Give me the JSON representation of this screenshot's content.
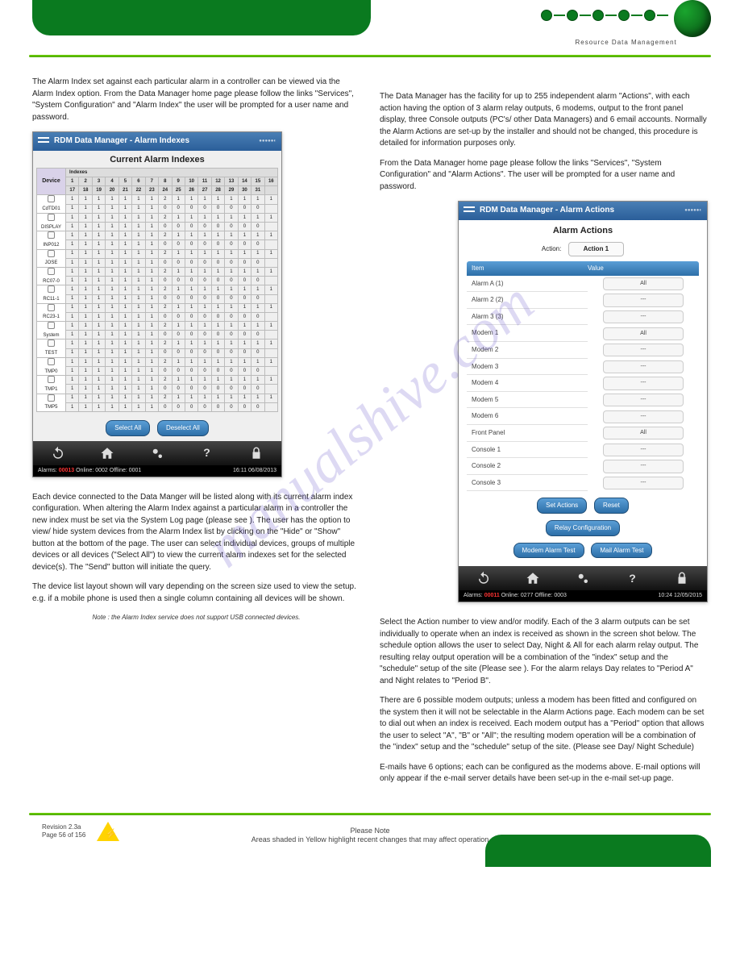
{
  "header": {
    "brand": "Resource Data Management"
  },
  "left": {
    "intro": "The Alarm Index set against each particular alarm in a controller can be viewed via the Alarm Index option. From the Data Manager home page please follow the links \"Services\", \"System Configuration\" and \"Alarm Index\" the user will be prompted for a user name and password.",
    "body": "Each device connected to the Data Manger will be listed along with its current alarm index configuration. When altering the Alarm Index against a particular alarm in a controller the new index must be set via the System Log page (please see ). The user has the option to view/ hide system devices from the Alarm Index list by clicking on the \"Hide\" or \"Show\" button at the bottom of the page. The user can select individual devices, groups of multiple devices or all devices (\"Select All\") to view the current alarm indexes set for the selected device(s). The \"Send\" button will initiate the query.",
    "listLabel": "The device list layout shown will vary depending on the screen size used to view the setup. e.g. if a mobile phone is used then a single column containing all devices will be shown.",
    "note": "Note : the Alarm Index service does not support USB connected devices."
  },
  "right": {
    "intro": "The Data Manager has the facility for up to 255 independent alarm \"Actions\", with each action having the option of 3 alarm relay outputs, 6 modems, output to the front panel display, three Console outputs (PC's/ other Data Managers) and 6 email accounts. Normally the Alarm Actions are set-up by the installer and should not be changed, this procedure is detailed for information purposes only.",
    "body": "From the Data Manager home page please follow the links \"Services\", \"System Configuration\" and \"Alarm Actions\". The user will be prompted for a user name and password.",
    "cfg1": "Select the Action number to view and/or modify. Each of the 3 alarm outputs can be set individually to operate when an index is received as shown in the screen shot below. The schedule option allows the user to select Day, Night & All for each alarm relay output. The resulting relay output operation will be a combination of the \"index\" setup and the \"schedule\" setup of the site (Please see ). For the alarm relays Day relates to \"Period A\" and Night relates to \"Period B\".",
    "cfg2": "There are 6 possible modem outputs; unless a modem has been fitted and configured on the system then it will not be selectable in the Alarm Actions page. Each modem can be set to dial out when an index is received. Each modem output has a \"Period\" option that allows the user to select \"A\", \"B\" or \"All\"; the resulting modem operation will be a combination of the \"index\" setup and the \"schedule\" setup of the site. (Please see Day/ Night Schedule)",
    "cfg3": "E-mails have 6 options; each can be configured as the modems above. E-mail options will only appear if the e-mail server details have been set-up in the e-mail set-up page."
  },
  "ss1": {
    "title": "RDM Data Manager - Alarm Indexes",
    "subtitle": "Current Alarm Indexes",
    "deviceHeader": "Device",
    "indexesHeader": "Indexes",
    "colsTop": [
      "1",
      "2",
      "3",
      "4",
      "5",
      "6",
      "7",
      "8",
      "9",
      "10",
      "11",
      "12",
      "13",
      "14",
      "15",
      "16"
    ],
    "colsBot": [
      "17",
      "18",
      "19",
      "20",
      "21",
      "22",
      "23",
      "24",
      "25",
      "26",
      "27",
      "28",
      "29",
      "30",
      "31",
      ""
    ],
    "rowTop": [
      "1",
      "1",
      "1",
      "1",
      "1",
      "1",
      "1",
      "2",
      "1",
      "1",
      "1",
      "1",
      "1",
      "1",
      "1",
      "1"
    ],
    "rowBot": [
      "1",
      "1",
      "1",
      "1",
      "1",
      "1",
      "1",
      "0",
      "0",
      "0",
      "0",
      "0",
      "0",
      "0",
      "0",
      ""
    ],
    "devices": [
      "CdTD01",
      "DISPLAY",
      "INP012",
      "JOSE",
      "RC07-0",
      "RC11-1",
      "RC23-1",
      "System",
      "TEST",
      "TMP0",
      "TMP1",
      "TMP5"
    ],
    "btnSelectAll": "Select All",
    "btnDeselectAll": "Deselect All",
    "statusLeft": {
      "alarmsLabel": "Alarms:",
      "alarmsVal": "00013",
      "rest": "Online: 0002 Offline: 0001"
    },
    "statusRight": "16:11 06/08/2013"
  },
  "ss2": {
    "title": "RDM Data Manager - Alarm Actions",
    "subtitle": "Alarm Actions",
    "actionLabel": "Action:",
    "actionVal": "Action 1",
    "headItem": "Item",
    "headValue": "Value",
    "rows": [
      {
        "k": "Alarm A (1)",
        "v": "All"
      },
      {
        "k": "Alarm 2 (2)",
        "v": "---"
      },
      {
        "k": "Alarm 3 (3)",
        "v": "---"
      },
      {
        "k": "Modem 1",
        "v": "All"
      },
      {
        "k": "Modem 2",
        "v": "---"
      },
      {
        "k": "Modem 3",
        "v": "---"
      },
      {
        "k": "Modem 4",
        "v": "---"
      },
      {
        "k": "Modem 5",
        "v": "---"
      },
      {
        "k": "Modem 6",
        "v": "---"
      },
      {
        "k": "Front Panel",
        "v": "All"
      },
      {
        "k": "Console 1",
        "v": "---"
      },
      {
        "k": "Console 2",
        "v": "---"
      },
      {
        "k": "Console 3",
        "v": "---"
      }
    ],
    "btnSetActions": "Set Actions",
    "btnReset": "Reset",
    "btnRelay": "Relay Configuration",
    "btnModemTest": "Modem Alarm Test",
    "btnMailTest": "Mail Alarm Test",
    "statusLeft": {
      "alarmsLabel": "Alarms:",
      "alarmsVal": "00011",
      "rest": "Online: 0277 Offline: 0003"
    },
    "statusRight": "10:24 12/05/2015"
  },
  "footer": {
    "rev": "Revision 2.3a",
    "page": "Page 56 of 156",
    "warnTitle": "Please Note",
    "warn": "Areas shaded in Yellow highlight recent changes that may affect operation"
  },
  "watermark": "manualshive.com"
}
